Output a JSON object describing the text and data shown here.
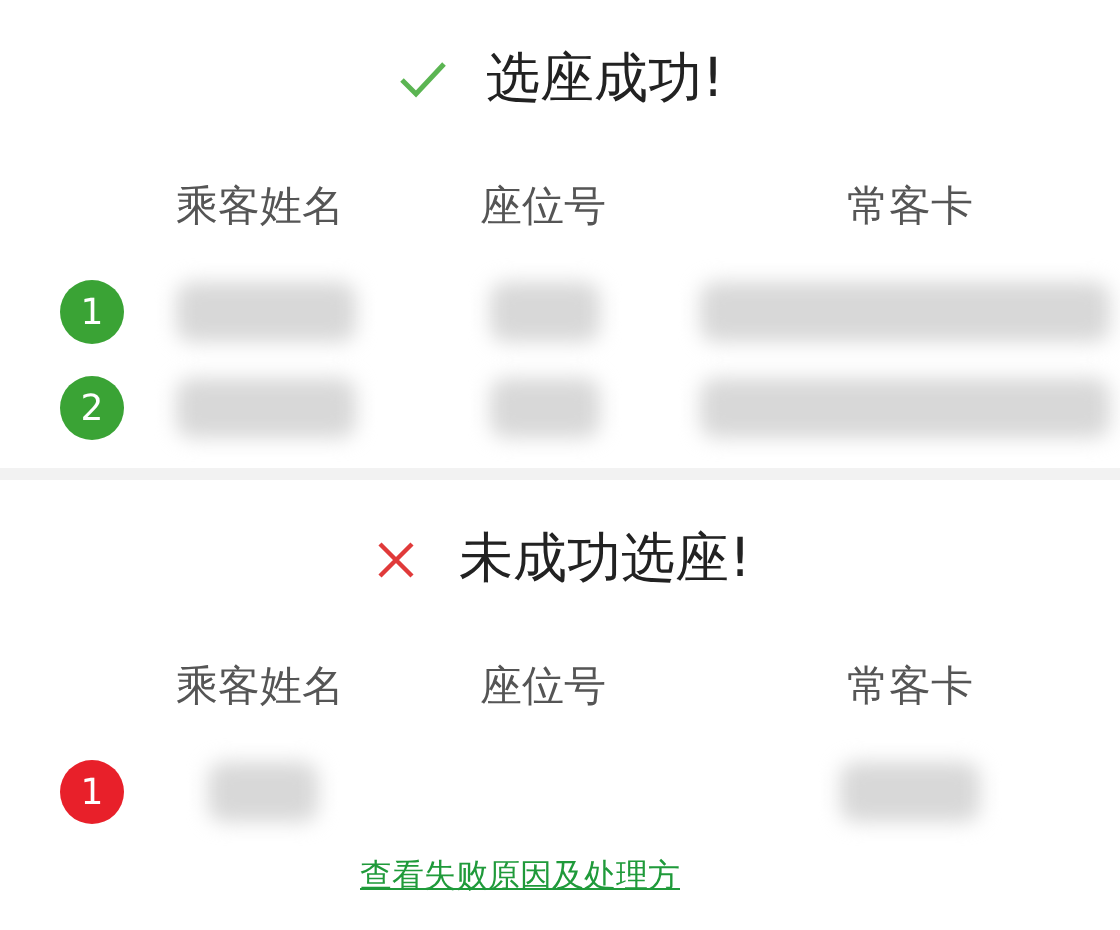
{
  "sections": [
    {
      "kind": "success",
      "title": "选座成功!",
      "columns": [
        "乘客姓名",
        "座位号",
        "常客卡"
      ],
      "rows": [
        {
          "number": "1"
        },
        {
          "number": "2"
        }
      ]
    },
    {
      "kind": "failure",
      "title": "未成功选座!",
      "columns": [
        "乘客姓名",
        "座位号",
        "常客卡"
      ],
      "rows": [
        {
          "number": "1"
        }
      ],
      "link": "查看失败原因及处理方"
    }
  ]
}
